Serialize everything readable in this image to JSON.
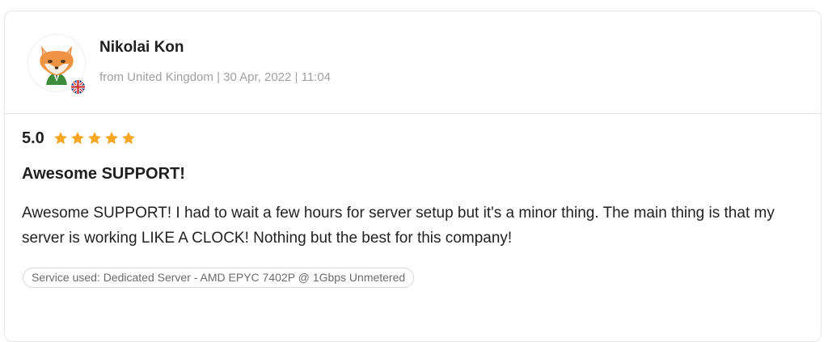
{
  "review": {
    "reviewer_name": "Nikolai Kon",
    "meta": "from United Kingdom | 30 Apr, 2022 | 11:04",
    "avatar_icon": "fox-avatar-icon",
    "country_flag_icon": "uk-flag-icon",
    "score": "5.0",
    "stars": 5,
    "star_color": "#f5a623",
    "title": "Awesome SUPPORT!",
    "body": "Awesome SUPPORT! I had to wait a few hours for server setup but it's a minor thing. The main thing is that my server is working LIKE A CLOCK! Nothing but the best for this company!",
    "service_used": "Service used: Dedicated Server - AMD EPYC 7402P @ 1Gbps Unmetered"
  }
}
